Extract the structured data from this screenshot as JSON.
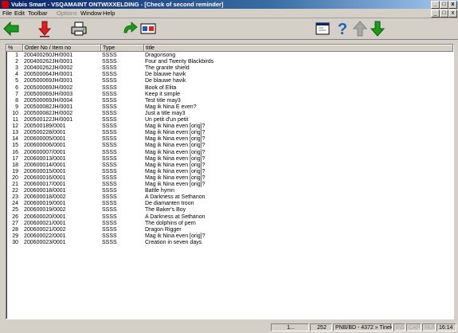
{
  "window": {
    "title": "Vubis Smart - VSQAMAINT ONTWIXXELDING - [Check of second reminder]",
    "minimize": "_",
    "restore": "□",
    "close": "x"
  },
  "menu": {
    "file": "File",
    "edit": "Edit",
    "toolbar": "Toolbar",
    "options": "Options",
    "window": "Window",
    "help": "Help"
  },
  "toolbar_icons": {
    "back": "arrow-left-icon",
    "select": "arrow-down-red-icon",
    "print": "printer-icon",
    "redo": "redo-arrow-icon",
    "form": "form-icon",
    "window": "window-icon",
    "help": "help-icon",
    "up": "arrow-up-icon",
    "down": "arrow-down-icon"
  },
  "columns": {
    "pct": "%",
    "order": "Order No / Item no",
    "type": "Type",
    "title": "title"
  },
  "rows": [
    {
      "n": "1",
      "order": "200400260JH/0001",
      "type": "SSSS",
      "title": "Dragonsong"
    },
    {
      "n": "2",
      "order": "200400262JH/0001",
      "type": "SSSS",
      "title": "Four and Twenty Blackbirds"
    },
    {
      "n": "3",
      "order": "200400262JH/0002",
      "type": "SSSS",
      "title": "The granite shield"
    },
    {
      "n": "4",
      "order": "200500064JH/0001",
      "type": "SSSS",
      "title": "De blauwe havik"
    },
    {
      "n": "5",
      "order": "200500069JH/0001",
      "type": "SSSS",
      "title": "De blauwe havik"
    },
    {
      "n": "6",
      "order": "200500069JH/0002",
      "type": "SSSS",
      "title": "Book of Elita"
    },
    {
      "n": "7",
      "order": "200500069JH/0003",
      "type": "SSSS",
      "title": "Keep it simple"
    },
    {
      "n": "8",
      "order": "200500069JH/0004",
      "type": "SSSS",
      "title": "Test title may3"
    },
    {
      "n": "9",
      "order": "200500082JH/0001",
      "type": "SSSS",
      "title": "Mag ik Nina E even?"
    },
    {
      "n": "10",
      "order": "200500082JH/0002",
      "type": "SSSS",
      "title": "Just a title may3"
    },
    {
      "n": "11",
      "order": "200500122JH/0001",
      "type": "SSSS",
      "title": "Un petit d'un petit"
    },
    {
      "n": "12",
      "order": "200500189/0001",
      "type": "SSSS",
      "title": "Mag ik Nina even [orig]?"
    },
    {
      "n": "13",
      "order": "200500228/0001",
      "type": "SSSS",
      "title": "Mag ik Nina even [orig]?"
    },
    {
      "n": "14",
      "order": "200600005/0001",
      "type": "SSSS",
      "title": "Mag ik Nina even [orig]?"
    },
    {
      "n": "15",
      "order": "200600006/0001",
      "type": "SSSS",
      "title": "Mag ik Nina even [orig]?"
    },
    {
      "n": "16",
      "order": "200600007/0001",
      "type": "SSSS",
      "title": "Mag ik Nina even [orig]?"
    },
    {
      "n": "17",
      "order": "200600013/0001",
      "type": "SSSS",
      "title": "Mag ik Nina even [orig]?"
    },
    {
      "n": "18",
      "order": "200600014/0001",
      "type": "SSSS",
      "title": "Mag ik Nina even [orig]?"
    },
    {
      "n": "19",
      "order": "200600015/0001",
      "type": "SSSS",
      "title": "Mag ik Nina even [orig]?"
    },
    {
      "n": "20",
      "order": "200600016/0001",
      "type": "SSSS",
      "title": "Mag ik Nina even [orig]?"
    },
    {
      "n": "21",
      "order": "200600017/0001",
      "type": "SSSS",
      "title": "Mag ik Nina even [orig]?"
    },
    {
      "n": "22",
      "order": "200600018/0001",
      "type": "SSSS",
      "title": "Battle hymn"
    },
    {
      "n": "23",
      "order": "200600018/0002",
      "type": "SSSS",
      "title": "A Darkness at Sethanon"
    },
    {
      "n": "24",
      "order": "200600019/0001",
      "type": "SSSS",
      "title": "De diamanten troon"
    },
    {
      "n": "25",
      "order": "200600019/0002",
      "type": "SSSS",
      "title": "The Baker's Boy"
    },
    {
      "n": "26",
      "order": "200600020/0001",
      "type": "SSSS",
      "title": "A Darkness at Sethanon"
    },
    {
      "n": "27",
      "order": "200600021/0001",
      "type": "SSSS",
      "title": "The dolphins of pern"
    },
    {
      "n": "28",
      "order": "200600021/0002",
      "type": "SSSS",
      "title": "Dragon Rigger"
    },
    {
      "n": "29",
      "order": "200600022/0001",
      "type": "SSSS",
      "title": "Mag ik Nina even [orig]?"
    },
    {
      "n": "30",
      "order": "200600023/0001",
      "type": "SSSS",
      "title": "Creation in seven days"
    }
  ],
  "status": {
    "page": "1...",
    "count": "252",
    "user": "PNB/BD - 4372 » Tineke",
    "ins": "INS",
    "caps": "CAPS",
    "num": "NUM",
    "time": "16:14"
  }
}
